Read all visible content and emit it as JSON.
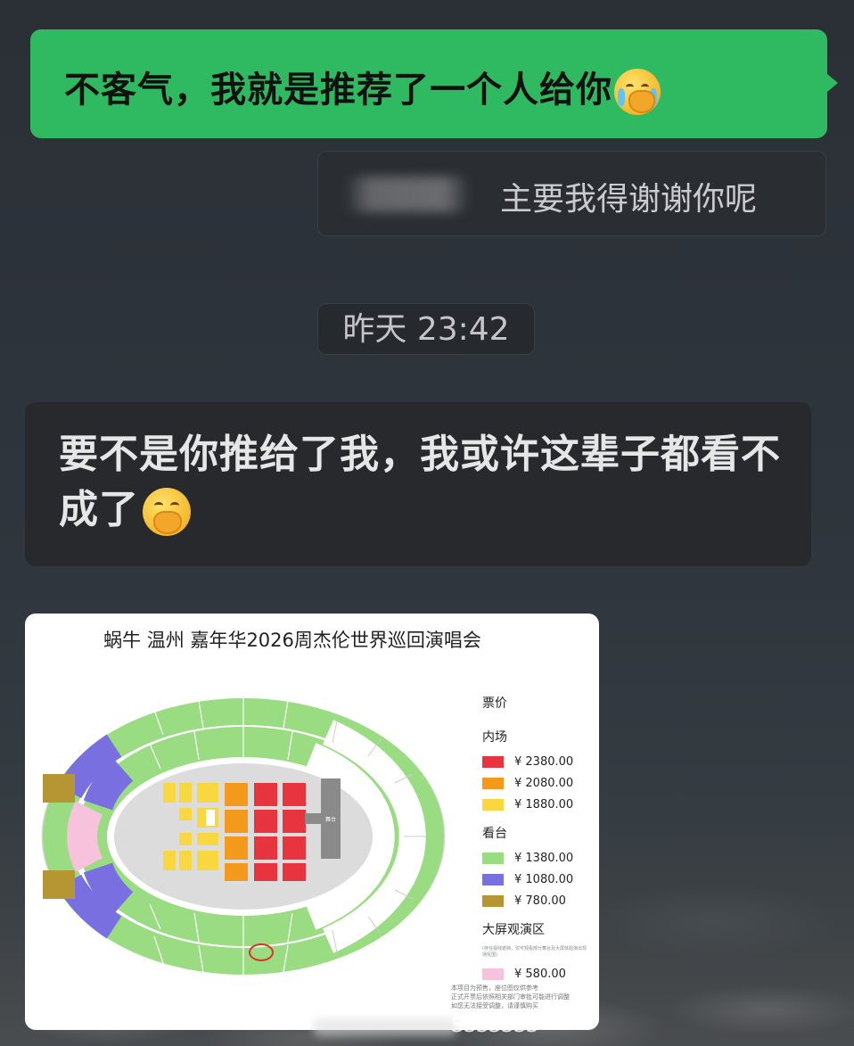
{
  "messages": {
    "sent": {
      "text": "不客气，我就是推荐了一个人给你",
      "emoji": "laughing-crying-emoji",
      "bubble_color": "#2fba61"
    },
    "quote": {
      "text": "主要我得谢谢你呢"
    },
    "timestamp": "昨天 23:42",
    "received": {
      "text": "要不是你推给了我，我或许这辈子都看不成了",
      "emoji": "face-with-hand-over-mouth-emoji",
      "bubble_color": "#27292c"
    }
  },
  "image": {
    "title": "蜗牛 温州 嘉年华2026周杰伦世界巡回演唱会",
    "stage_label": "舞台",
    "legend": {
      "heading": "票价",
      "sections": [
        {
          "name": "内场",
          "tiers": [
            {
              "price": "¥ 2380.00",
              "color": "#e8343f"
            },
            {
              "price": "¥ 2080.00",
              "color": "#f39a1d"
            },
            {
              "price": "¥ 1880.00",
              "color": "#f9d740"
            }
          ]
        },
        {
          "name": "看台",
          "tiers": [
            {
              "price": "¥ 1380.00",
              "color": "#9adc82"
            },
            {
              "price": "¥ 1080.00",
              "color": "#7a6fe0"
            },
            {
              "price": "¥ 780.00",
              "color": "#b59632"
            }
          ]
        },
        {
          "name": "大屏观演区",
          "note": "(存在视线遮挡，仅可观看部分舞台及大屏体验演出现场氛围)",
          "tiers": [
            {
              "price": "¥ 580.00",
              "color": "#f6c2dc"
            }
          ]
        }
      ]
    },
    "footnote": "本项目为预售，座位图仅供参考\n正式开票后依照相关部门审批可能进行调整\n如您无法接受调整，请谨慎购买"
  },
  "watermark": "SSSSSSS"
}
